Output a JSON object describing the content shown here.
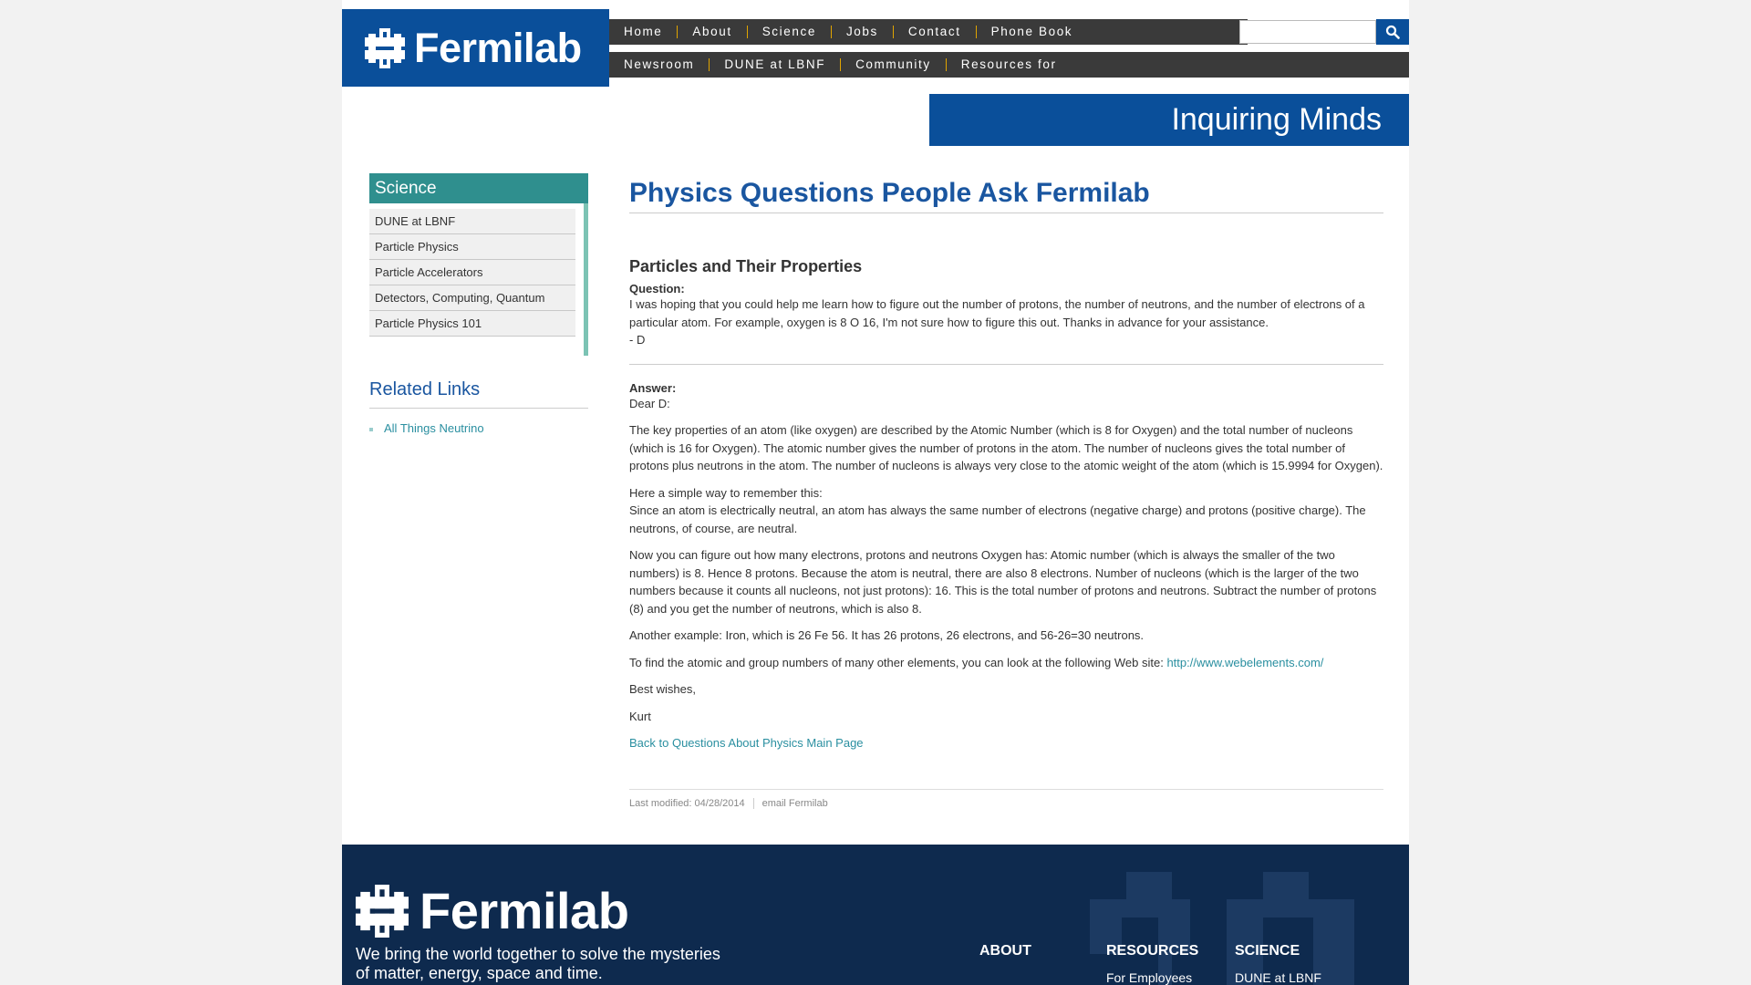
{
  "header": {
    "logo_text": "Fermilab",
    "nav_top": [
      "Home",
      "About",
      "Science",
      "Jobs",
      "Contact",
      "Phone Book"
    ],
    "nav_bottom": [
      "Newsroom",
      "DUNE at LBNF",
      "Community",
      "Resources for"
    ],
    "search_placeholder": "",
    "banner": "Inquiring Minds"
  },
  "sidebar": {
    "heading": "Science",
    "items": [
      "DUNE at LBNF",
      "Particle Physics",
      "Particle Accelerators",
      "Detectors, Computing, Quantum",
      "Particle Physics 101"
    ],
    "related_title": "Related Links",
    "related_links": [
      "All Things Neutrino"
    ]
  },
  "main": {
    "title": "Physics Questions People Ask Fermilab",
    "section": "Particles and Their Properties",
    "question_label": "Question:",
    "question_text": "I was hoping that you could help me learn how to figure out the number of protons, the number of neutrons, and the number of electrons of a particular atom. For example, oxygen is 8 O 16, I'm not sure how to figure this out. Thanks in advance for your assistance.",
    "question_sign": "- D",
    "answer_label": "Answer:",
    "greeting": "Dear D:",
    "p1": "The key properties of an atom (like oxygen) are described by the Atomic Number (which is 8 for Oxygen) and the total number of nucleons (which is 16 for Oxygen). The atomic number gives the number of protons in the atom. The number of nucleons gives the total number of protons plus neutrons in the atom. The number of nucleons is always very close to the atomic weight of the atom (which is 15.9994 for Oxygen).",
    "p2a": "Here a simple way to remember this:",
    "p2b": "Since an atom is electrically neutral, an atom has always the same number of electrons (negative charge) and protons (positive charge). The neutrons, of course, are neutral.",
    "p3": "Now you can figure out how many electrons, protons and neutrons Oxygen has: Atomic number (which is always the smaller of the two numbers) is 8. Hence 8 protons. Because the atom is neutral, there are also 8 electrons. Number of nucleons (which is the larger of the two numbers because it counts all nucleons, not just protons): 16. This is the total number of protons and neutrons. Subtract the number of protons (8) and you get the number of neutrons, which is also 8.",
    "p4": "Another example: Iron, which is 26 Fe 56. It has 26 protons, 26 electrons, and 56-26=30 neutrons.",
    "p5": "To find the atomic and group numbers of many other elements, you can look at the following Web site:",
    "p5_link": "http://www.webelements.com/",
    "closing": "Best wishes,",
    "signature": "Kurt",
    "back_link": "Back to Questions About Physics Main Page",
    "last_modified": "Last modified: 04/28/2014",
    "email_link": "email Fermilab"
  },
  "footer": {
    "logo_text": "Fermilab",
    "tagline": "We bring the world together to solve the mysteries of matter, energy, space and time.",
    "col_about": "ABOUT",
    "col_resources": "RESOURCES",
    "col_resources_item": "For Employees",
    "col_science": "SCIENCE",
    "col_science_item": "DUNE at LBNF"
  },
  "colors": {
    "brand_blue": "#0a4f9a",
    "nav_dark": "#3a3a3a",
    "nav_separator": "#e0a400",
    "sidebar_teal": "#2f8f8e",
    "link_teal": "#2a8fa0",
    "footer_navy": "#0e2a4e"
  }
}
